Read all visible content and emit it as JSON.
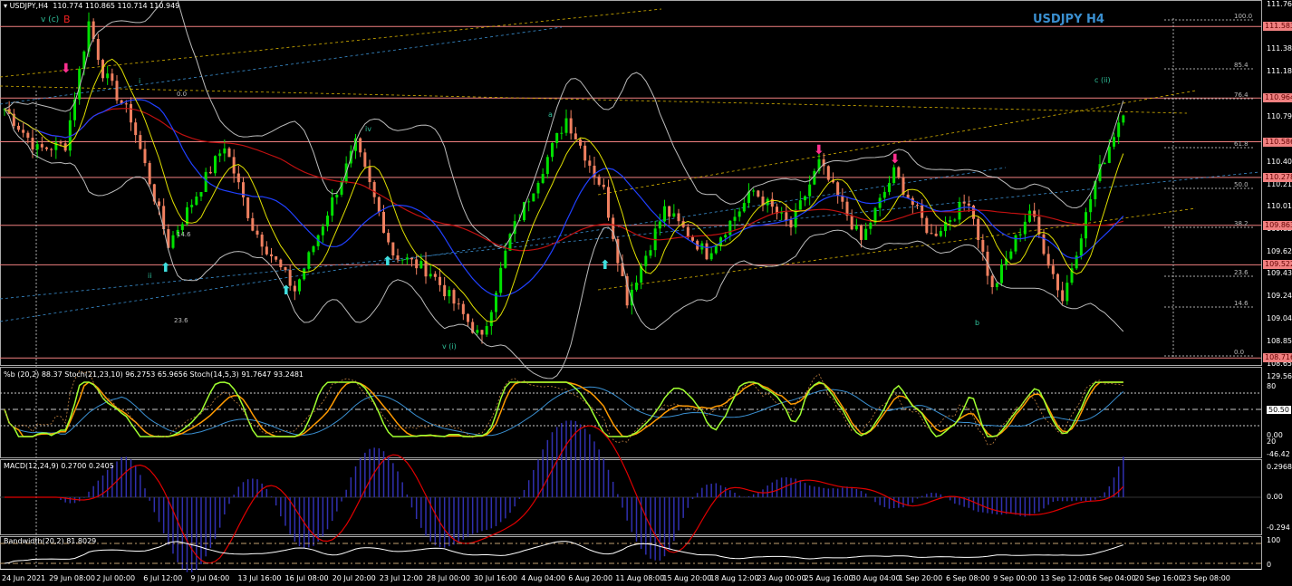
{
  "header": {
    "symbol": "USDJPY,H4",
    "ohlc": "110.774 110.865 110.714 110.949"
  },
  "title": "USDJPY H4",
  "colors": {
    "bull": "#00e000",
    "bear": "#f08060",
    "level": "#f08080",
    "fib": "#cccccc",
    "accent": "#3a8fd0"
  },
  "price_axis": {
    "max": 111.765,
    "min": 108.655,
    "ticks": [
      "111.765",
      "111.380",
      "111.185",
      "110.795",
      "110.405",
      "110.210",
      "110.015",
      "109.820",
      "109.625",
      "109.435",
      "109.240",
      "109.045",
      "108.850",
      "108.655"
    ]
  },
  "levels": [
    "111.583",
    "110.964",
    "110.586",
    "110.278",
    "109.863",
    "109.522",
    "108.716"
  ],
  "fib_labels": [
    "100.0",
    "85.4",
    "76.4",
    "61.8",
    "50.0",
    "38.2",
    "23.6",
    "14.6",
    "0.0"
  ],
  "left_fib_labels": [
    "0.0",
    "14.6",
    "23.6"
  ],
  "waves": {
    "top": "v (c)",
    "topB": "B",
    "i": "i",
    "ii": "ii",
    "iv": "iv",
    "a": "a",
    "v_i": "v (i)",
    "b": "b",
    "c_ii": "c (ii)"
  },
  "price_path": [
    [
      0,
      110.87
    ],
    [
      7,
      110.52
    ],
    [
      13,
      110.56
    ],
    [
      18,
      111.62
    ],
    [
      21,
      111.19
    ],
    [
      27,
      110.79
    ],
    [
      35,
      109.7
    ],
    [
      47,
      110.56
    ],
    [
      53,
      109.85
    ],
    [
      62,
      109.3
    ],
    [
      75,
      110.56
    ],
    [
      83,
      109.62
    ],
    [
      91,
      109.46
    ],
    [
      102,
      108.87
    ],
    [
      108,
      109.77
    ],
    [
      120,
      110.79
    ],
    [
      128,
      110.16
    ],
    [
      133,
      109.22
    ],
    [
      141,
      110.0
    ],
    [
      150,
      109.62
    ],
    [
      160,
      110.16
    ],
    [
      168,
      109.85
    ],
    [
      174,
      110.4
    ],
    [
      183,
      109.73
    ],
    [
      190,
      110.32
    ],
    [
      198,
      109.77
    ],
    [
      206,
      110.09
    ],
    [
      211,
      109.3
    ],
    [
      219,
      110.0
    ],
    [
      226,
      109.22
    ],
    [
      233,
      110.24
    ],
    [
      239,
      110.87
    ]
  ],
  "stoch_pane": {
    "header": "%b (20,2) 88.37  Stoch(21,23,10) 96.2753 65.9656  Stoch(14,5,3) 91.7647 93.2481",
    "ticks": [
      "129.56",
      "80",
      "50.50",
      "0.00",
      "20",
      "-46.42"
    ]
  },
  "macd_pane": {
    "header": "MACD(12,24,9) 0.2700 0.2405",
    "ticks": [
      "0.2968",
      "0.00",
      "-0.294"
    ]
  },
  "bw_pane": {
    "header": "Bandwidth(20,2) 81.8029",
    "ticks": [
      "100",
      "0"
    ]
  },
  "time_axis": [
    "24 Jun 2021",
    "29 Jun 08:00",
    "2 Jul 00:00",
    "6 Jul 12:00",
    "9 Jul 04:00",
    "13 Jul 16:00",
    "16 Jul 08:00",
    "20 Jul 20:00",
    "23 Jul 12:00",
    "28 Jul 00:00",
    "30 Jul 16:00",
    "4 Aug 04:00",
    "6 Aug 20:00",
    "11 Aug 08:00",
    "15 Aug 20:00",
    "18 Aug 12:00",
    "23 Aug 00:00",
    "25 Aug 16:00",
    "30 Aug 04:00",
    "1 Sep 20:00",
    "6 Sep 08:00",
    "9 Sep 00:00",
    "13 Sep 12:00",
    "16 Sep 04:00",
    "20 Sep 16:00",
    "23 Sep 08:00"
  ]
}
